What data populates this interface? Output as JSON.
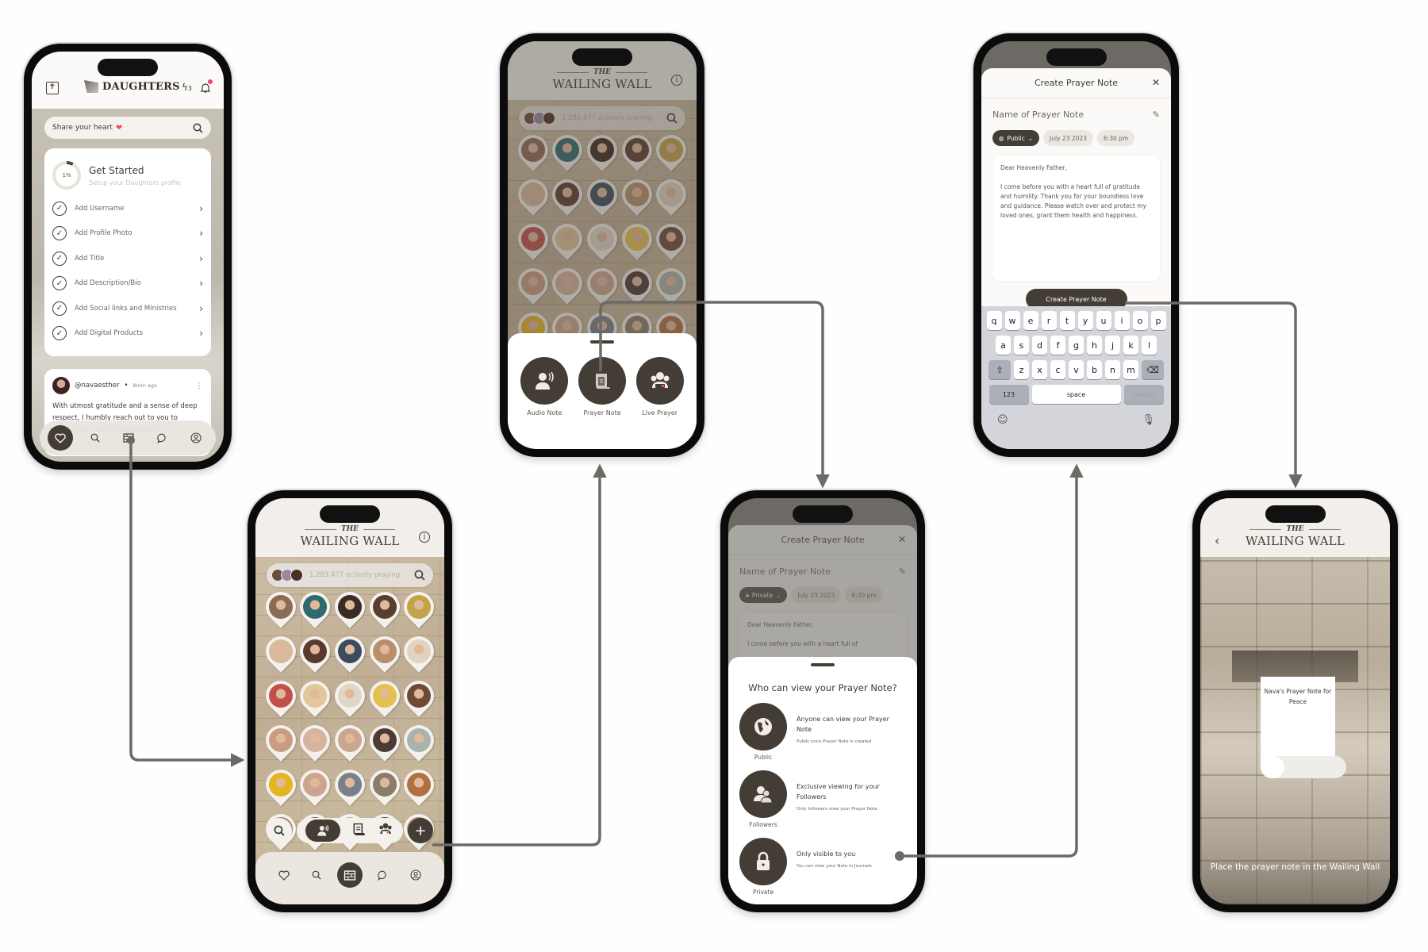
{
  "flow": {
    "connector_color": "#6d6a66",
    "accent_dark": "#433d36",
    "accent_pink": "#ef4867"
  },
  "phone1": {
    "brand": "DAUGHTERS",
    "bolt_count": "3",
    "search_placeholder": "Share your heart",
    "get_started": {
      "title": "Get Started",
      "subtitle": "Setup your Daughters profile",
      "progress_label": "1%",
      "progress_percent": 1
    },
    "tasks": [
      {
        "label": "Add Username"
      },
      {
        "label": "Add Profile Photo"
      },
      {
        "label": "Add Title"
      },
      {
        "label": "Add Description/Bio"
      },
      {
        "label": "Add Social links and Ministries"
      },
      {
        "label": "Add Digital Products"
      }
    ],
    "post": {
      "username": "@navaesther",
      "time": "8min ago",
      "text": "With utmost gratitude and a sense of deep respect, I humbly reach out to you to extend my heartfelt appreciation for"
    },
    "tabs": [
      "heart-icon",
      "search-icon",
      "wall-icon",
      "chat-icon",
      "profile-icon"
    ]
  },
  "wall": {
    "the": "THE",
    "title": "WAILING WALL",
    "active_count": "1,283,477 actively praying"
  },
  "phone3": {
    "actions": [
      {
        "label": "Audio Note",
        "icon": "audio-note-icon"
      },
      {
        "label": "Prayer Note",
        "icon": "prayer-note-icon"
      },
      {
        "label": "Live Prayer",
        "icon": "live-prayer-icon"
      }
    ]
  },
  "phone2": {
    "plus": "+"
  },
  "create_note": {
    "title": "Create Prayer Note",
    "name_placeholder": "Name of Prayer Note",
    "visibility_public": "Public",
    "visibility_private": "Private",
    "date": "July 23 2023",
    "time": "6:30 pm",
    "greeting": "Dear Heavenly Father,",
    "body": "I come before you with a heart full of gratitude and humility. Thank you for your boundless love and guidance. Please watch over and protect my loved ones, grant them health and happiness.",
    "body_short": "I come before you with a heart full of",
    "button": "Create Prayer Note"
  },
  "keyboard": {
    "row1": [
      "q",
      "w",
      "e",
      "r",
      "t",
      "y",
      "u",
      "i",
      "o",
      "p"
    ],
    "row2": [
      "a",
      "s",
      "d",
      "f",
      "g",
      "h",
      "j",
      "k",
      "l"
    ],
    "row3": [
      "z",
      "x",
      "c",
      "v",
      "b",
      "n",
      "m"
    ],
    "numbers": "123",
    "space": "space",
    "search": "search"
  },
  "visibility_sheet": {
    "question": "Who can view your Prayer Note?",
    "options": [
      {
        "label": "Public",
        "title": "Anyone can view your Prayer Note",
        "detail": "Public once Prayer Note is created"
      },
      {
        "label": "Followers",
        "title": "Exclusive viewing for your Followers",
        "detail": "Only followers view your Prayer Note"
      },
      {
        "label": "Private",
        "title": "Only visible to you",
        "detail": "You can view your Note in Journals"
      }
    ]
  },
  "phone6": {
    "note_title": "Nava's Prayer Note for Peace",
    "caption": "Place the prayer note in the Wailing Wall"
  }
}
